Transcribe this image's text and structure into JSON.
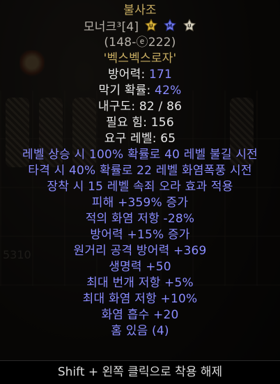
{
  "item": {
    "name": "불사조",
    "base_line": "모너크³[4]",
    "badges": [
      "quality-gold-icon",
      "quality-blue-icon",
      "quality-white-icon"
    ],
    "badge_letters": [
      "U",
      "M",
      "U"
    ],
    "range": "(148-ⓔ222)",
    "runeword": "'벡스벡스로자'",
    "defense_label": "방어력: ",
    "defense_value": "171",
    "block_label": "막기 확률: ",
    "block_value": "42%",
    "durability": "내구도: 82 / 86",
    "req_str": "필요 힘: 156",
    "req_level": "요구 레벨: 65",
    "mods": [
      "레벨 상승 시 100% 확률로 40 레벨 불길 시전",
      "타격 시 40% 확률로 22 레벨 화염폭풍 시전",
      "장착 시 15 레벨 속죄 오라 효과 적용",
      "피해 +359% 증가",
      "적의 화염 저항 -28%",
      "방어력 +15% 증가",
      "원거리 공격 방어력 +369",
      "생명력 +50",
      "최대 번개 저항 +5%",
      "최대 화염 저항 +10%",
      "화염 흡수 +20",
      "홈 있음 (4)"
    ]
  },
  "footer": {
    "hint": "Shift + 왼쪽 클릭으로 착용 해제"
  },
  "background": {
    "counter": "5310"
  },
  "colors": {
    "unique_gold": "#c8ad62",
    "magic_blue": "#8a8cff",
    "base_gray": "#b7b2aa",
    "text_white": "#e8e8e8"
  }
}
